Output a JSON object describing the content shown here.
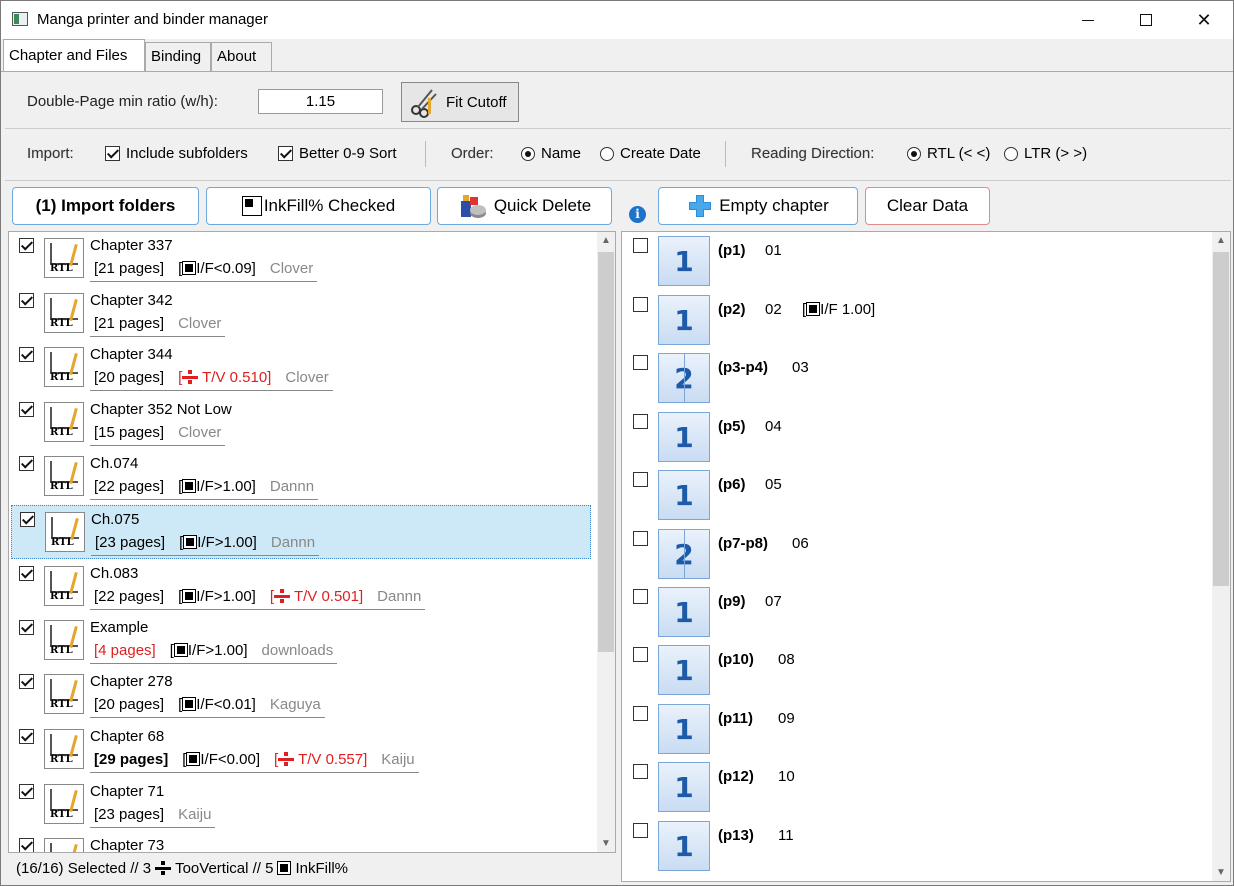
{
  "window": {
    "title": "Manga printer and binder manager"
  },
  "tabs": [
    {
      "label": "Chapter and Files"
    },
    {
      "label": "Binding"
    },
    {
      "label": "About"
    }
  ],
  "options": {
    "ratio_label": "Double-Page min ratio (w/h):",
    "ratio_value": "1.15",
    "fit_cutoff_label": "Fit Cutoff",
    "import_label": "Import:",
    "include_subfolders": "Include subfolders",
    "better_sort": "Better 0-9 Sort",
    "order_label": "Order:",
    "order_name": "Name",
    "order_date": "Create Date",
    "direction_label": "Reading Direction:",
    "dir_rtl": "RTL (< <)",
    "dir_ltr": "LTR (> >)"
  },
  "actions": {
    "import_folders": "(1) Import folders",
    "inkfill_checked": "InkFill% Checked",
    "quick_delete": "Quick Delete",
    "empty_chapter": "Empty chapter",
    "clear_data": "Clear Data"
  },
  "chapters": [
    {
      "name": "Chapter 337",
      "pages": "[21 pages]",
      "ink": "I/F<0.09]",
      "tv": "",
      "group": "Clover"
    },
    {
      "name": "Chapter 342",
      "pages": "[21 pages]",
      "ink": "",
      "tv": "",
      "group": "Clover"
    },
    {
      "name": "Chapter 344",
      "pages": "[20 pages]",
      "ink": "",
      "tv": "T/V 0.510]",
      "group": "Clover"
    },
    {
      "name": "Chapter 352 Not Low",
      "pages": "[15 pages]",
      "ink": "",
      "tv": "",
      "group": "Clover"
    },
    {
      "name": "Ch.074",
      "pages": "[22 pages]",
      "ink": "I/F>1.00]",
      "tv": "",
      "group": "Dannn"
    },
    {
      "name": "Ch.075",
      "pages": "[23 pages]",
      "ink": "I/F>1.00]",
      "tv": "",
      "group": "Dannn"
    },
    {
      "name": "Ch.083",
      "pages": "[22 pages]",
      "ink": "I/F>1.00]",
      "tv": "T/V 0.501]",
      "group": "Dannn"
    },
    {
      "name": "Example",
      "pages": "[4 pages]",
      "ink": "I/F>1.00]",
      "tv": "",
      "group": "downloads"
    },
    {
      "name": "Chapter 278",
      "pages": "[20 pages]",
      "ink": "I/F<0.01]",
      "tv": "",
      "group": "Kaguya"
    },
    {
      "name": "Chapter 68",
      "pages": "[29 pages]",
      "ink": "I/F<0.00]",
      "tv": "T/V 0.557]",
      "group": "Kaiju"
    },
    {
      "name": "Chapter 71",
      "pages": "[23 pages]",
      "ink": "",
      "tv": "",
      "group": "Kaiju"
    },
    {
      "name": "Chapter 73",
      "pages": "",
      "ink": "",
      "tv": "",
      "group": ""
    }
  ],
  "pages": [
    {
      "icon": "1",
      "label": "(p1)",
      "file": "01",
      "ink": ""
    },
    {
      "icon": "1",
      "label": "(p2)",
      "file": "02",
      "ink": "I/F 1.00]"
    },
    {
      "icon": "2",
      "label": "(p3-p4)",
      "file": "03",
      "ink": ""
    },
    {
      "icon": "1",
      "label": "(p5)",
      "file": "04",
      "ink": ""
    },
    {
      "icon": "1",
      "label": "(p6)",
      "file": "05",
      "ink": ""
    },
    {
      "icon": "2",
      "label": "(p7-p8)",
      "file": "06",
      "ink": ""
    },
    {
      "icon": "1",
      "label": "(p9)",
      "file": "07",
      "ink": ""
    },
    {
      "icon": "1",
      "label": "(p10)",
      "file": "08",
      "ink": ""
    },
    {
      "icon": "1",
      "label": "(p11)",
      "file": "09",
      "ink": ""
    },
    {
      "icon": "1",
      "label": "(p12)",
      "file": "10",
      "ink": ""
    },
    {
      "icon": "1",
      "label": "(p13)",
      "file": "11",
      "ink": ""
    }
  ],
  "status": {
    "selected": "(16/16) Selected // 3",
    "too_vertical": "TooVertical // 5",
    "inkfill": "InkFill%"
  }
}
